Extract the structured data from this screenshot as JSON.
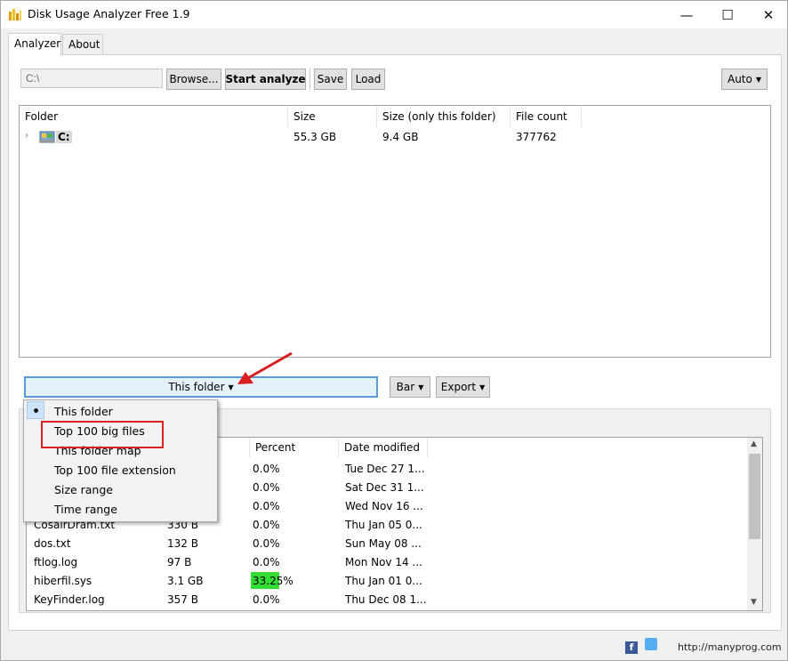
{
  "window": {
    "title": "Disk Usage Analyzer Free 1.9",
    "minimize": "—",
    "maximize": "☐",
    "close": "✕"
  },
  "tabs": [
    {
      "label": "Analyzer",
      "active": true
    },
    {
      "label": "About",
      "active": false
    }
  ],
  "toolbar": {
    "path_value": "C:\\",
    "browse_label": "Browse...",
    "start_label": "Start analyze",
    "save_label": "Save",
    "load_label": "Load",
    "auto_label": "Auto"
  },
  "tree": {
    "columns": [
      "Folder",
      "Size",
      "Size (only this folder)",
      "File count"
    ],
    "rows": [
      {
        "name": "C:",
        "size": "55.3 GB",
        "size_only": "9.4 GB",
        "file_count": "377762"
      }
    ]
  },
  "view_controls": {
    "view_label": "This folder",
    "bar_label": "Bar",
    "export_label": "Export"
  },
  "dropdown": {
    "items": [
      {
        "label": "This folder",
        "selected": true
      },
      {
        "label": "Top 100 big files",
        "selected": false
      },
      {
        "label": "This folder map",
        "selected": false
      },
      {
        "label": "Top 100 file extension",
        "selected": false
      },
      {
        "label": "Size range",
        "selected": false
      },
      {
        "label": "Time range",
        "selected": false
      }
    ]
  },
  "file_list": {
    "columns": [
      "Percent",
      "Date modified"
    ],
    "rows": [
      {
        "name": "",
        "size": "",
        "percent": "0.0%",
        "date": "Tue Dec 27 1..."
      },
      {
        "name": "",
        "size": "",
        "percent": "0.0%",
        "date": "Sat Dec 31 1..."
      },
      {
        "name": "",
        "size": "",
        "percent": "0.0%",
        "date": "Wed Nov 16 ..."
      },
      {
        "name": "CosairDram.txt",
        "size": "330 B",
        "percent": "0.0%",
        "date": "Thu Jan 05 0..."
      },
      {
        "name": "dos.txt",
        "size": "132 B",
        "percent": "0.0%",
        "date": "Sun May 08 ..."
      },
      {
        "name": "ftlog.log",
        "size": "97 B",
        "percent": "0.0%",
        "date": "Mon Nov 14 ..."
      },
      {
        "name": "hiberfil.sys",
        "size": "3.1 GB",
        "percent": "33.25%",
        "percent_fill": 0.3325,
        "date": "Thu Jan 01 0..."
      },
      {
        "name": "KeyFinder.log",
        "size": "357 B",
        "percent": "0.0%",
        "date": "Thu Dec 08 1..."
      }
    ]
  },
  "footer": {
    "site_text": "http://manyprog.com"
  },
  "colors": {
    "accent_border": "#5b9bd5",
    "percent_bar": "#33dd33",
    "highlight": "#e02020",
    "arrow": "#e02020"
  }
}
